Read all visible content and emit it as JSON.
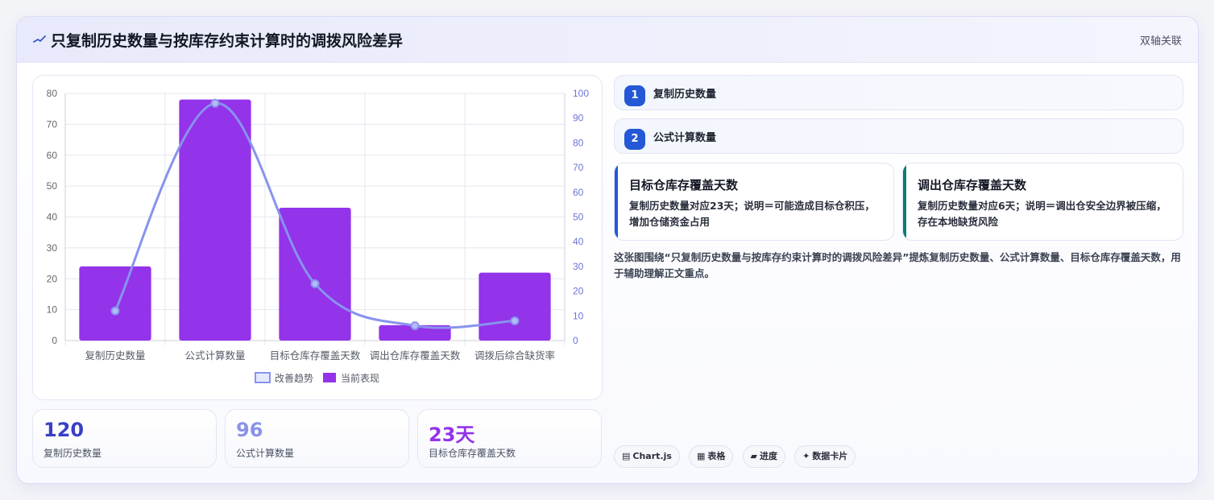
{
  "header": {
    "title": "只复制历史数量与按库存约束计算时的调拨风险差异",
    "tag": "双轴关联"
  },
  "chart_data": {
    "type": "bar+line",
    "categories": [
      "复制历史数量",
      "公式计算数量",
      "目标仓库存覆盖天数",
      "调出仓库存覆盖天数",
      "调拨后综合缺货率"
    ],
    "series": [
      {
        "name": "改善趋势",
        "type": "line",
        "axis": "right",
        "values": [
          12,
          96,
          23,
          6,
          8
        ],
        "color": "#8893ee"
      },
      {
        "name": "当前表现",
        "type": "bar",
        "axis": "left",
        "values": [
          24,
          78,
          43,
          5,
          22
        ],
        "color": "#9333ea"
      }
    ],
    "y_left": {
      "ticks": [
        0,
        10,
        20,
        30,
        40,
        50,
        60,
        70,
        80
      ],
      "ylim": [
        0,
        80
      ],
      "color": "#666666"
    },
    "y_right": {
      "ticks": [
        0,
        10,
        20,
        30,
        40,
        50,
        60,
        70,
        80,
        90,
        100
      ],
      "ylim": [
        0,
        100
      ],
      "color": "#6b74d6"
    },
    "grid": true,
    "legend_position": "bottom"
  },
  "stats": [
    {
      "value": "120",
      "label": "复制历史数量",
      "color": "#3a3fc6"
    },
    {
      "value": "96",
      "label": "公式计算数量",
      "color": "#8a92e8"
    },
    {
      "value": "23天",
      "label": "目标仓库存覆盖天数",
      "color": "#9333ea"
    }
  ],
  "steps": [
    {
      "num": "1",
      "label": "复制历史数量"
    },
    {
      "num": "2",
      "label": "公式计算数量"
    }
  ],
  "cards": [
    {
      "title": "目标仓库存覆盖天数",
      "text": "复制历史数量对应23天；说明＝可能造成目标仓积压，增加仓储资金占用",
      "color": "#2458d6"
    },
    {
      "title": "调出仓库存覆盖天数",
      "text": "复制历史数量对应6天；说明＝调出仓安全边界被压缩，存在本地缺货风险",
      "color": "#0e7c74"
    }
  ],
  "summary": "这张图围绕“只复制历史数量与按库存约束计算时的调拨风险差异”提炼复制历史数量、公式计算数量、目标仓库存覆盖天数，用于辅助理解正文重点。",
  "tags": [
    {
      "icon": "chart-icon",
      "glyph": "▤",
      "label": "Chart.js"
    },
    {
      "icon": "table-icon",
      "glyph": "▦",
      "label": "表格"
    },
    {
      "icon": "progress-icon",
      "glyph": "▰",
      "label": "进度"
    },
    {
      "icon": "sparkle-icon",
      "glyph": "✦",
      "label": "数据卡片"
    }
  ]
}
